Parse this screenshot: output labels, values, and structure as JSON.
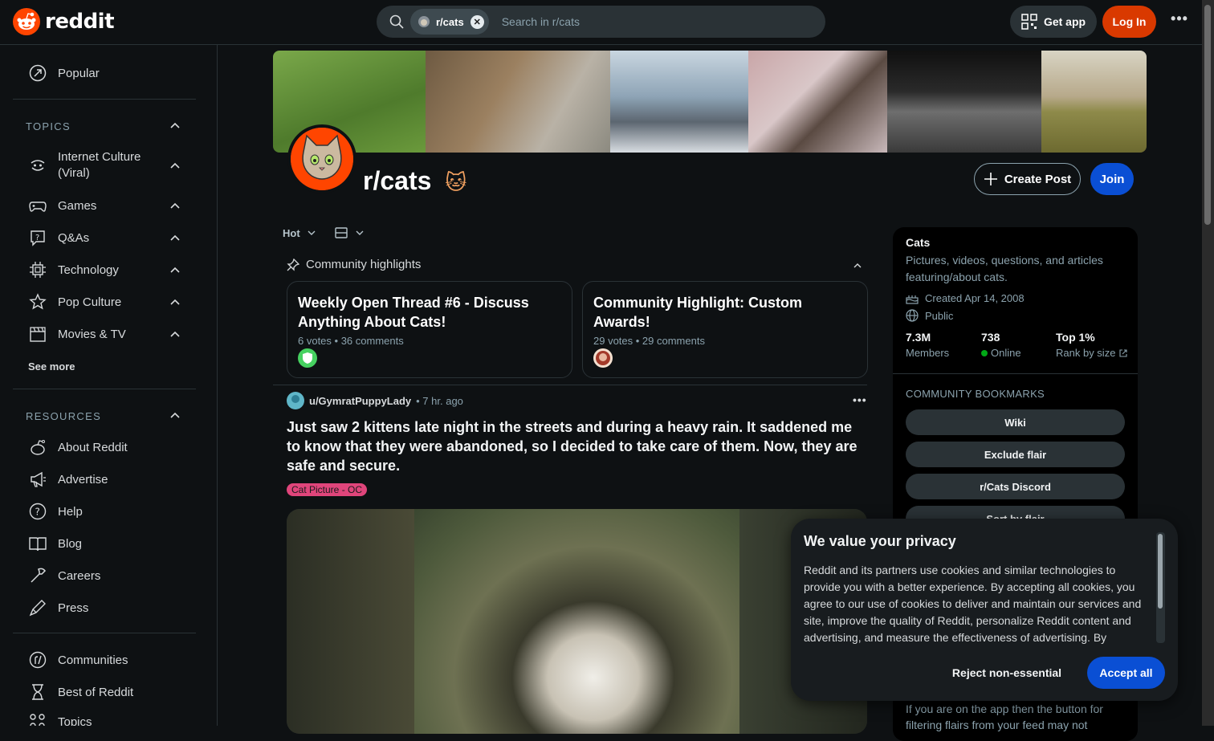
{
  "header": {
    "logo_text": "reddit",
    "search_chip": "r/cats",
    "search_placeholder": "Search in r/cats",
    "get_app": "Get app",
    "login": "Log In"
  },
  "sidebar": {
    "popular": "Popular",
    "topics_heading": "TOPICS",
    "topics": [
      {
        "label": "Internet Culture",
        "label2": "(Viral)"
      },
      {
        "label": "Games"
      },
      {
        "label": "Q&As"
      },
      {
        "label": "Technology"
      },
      {
        "label": "Pop Culture"
      },
      {
        "label": "Movies & TV"
      }
    ],
    "see_more": "See more",
    "resources_heading": "RESOURCES",
    "resources": [
      "About Reddit",
      "Advertise",
      "Help",
      "Blog",
      "Careers",
      "Press"
    ],
    "bottom": [
      "Communities",
      "Best of Reddit",
      "Topics"
    ]
  },
  "community": {
    "name": "r/cats",
    "create_post": "Create Post",
    "join": "Join"
  },
  "feed": {
    "sort": "Hot",
    "highlights_heading": "Community highlights",
    "highlights": [
      {
        "title": "Weekly Open Thread #6 - Discuss Anything About Cats!",
        "meta": "6 votes • 36 comments"
      },
      {
        "title": "Community Highlight: Custom Awards!",
        "meta": "29 votes • 29 comments"
      }
    ],
    "post": {
      "author": "u/GymratPuppyLady",
      "time": "• 7 hr. ago",
      "title": "Just saw 2 kittens late night in the streets and during a heavy rain. It saddened me to know that they were abandoned, so I decided to take care of them. Now, they are safe and secure.",
      "flair": "Cat Picture - OC"
    }
  },
  "about": {
    "name": "Cats",
    "description": "Pictures, videos, questions, and articles featuring/about cats.",
    "created": "Created Apr 14, 2008",
    "visibility": "Public",
    "members_value": "7.3M",
    "members_label": "Members",
    "online_value": "738",
    "online_label": "Online",
    "rank_value": "Top 1%",
    "rank_label": "Rank by size",
    "bookmarks_heading": "COMMUNITY BOOKMARKS",
    "bookmarks": [
      "Wiki",
      "Exclude flair",
      "r/Cats Discord",
      "Sort by flair"
    ],
    "bottom_text": "If you are on the app then the button for filtering flairs from your feed may not"
  },
  "cookie": {
    "title": "We value your privacy",
    "body": "Reddit and its partners use cookies and similar technologies to provide you with a better experience. By accepting all cookies, you agree to our use of cookies to deliver and maintain our services and site, improve the quality of Reddit, personalize Reddit content and advertising, and measure the effectiveness of advertising. By",
    "reject": "Reject non-essential",
    "accept": "Accept all"
  },
  "colors": {
    "brand": "#ff4500",
    "login": "#d93900",
    "join": "#0a4fd4",
    "online": "#01a816",
    "flair": "#e0457b"
  }
}
